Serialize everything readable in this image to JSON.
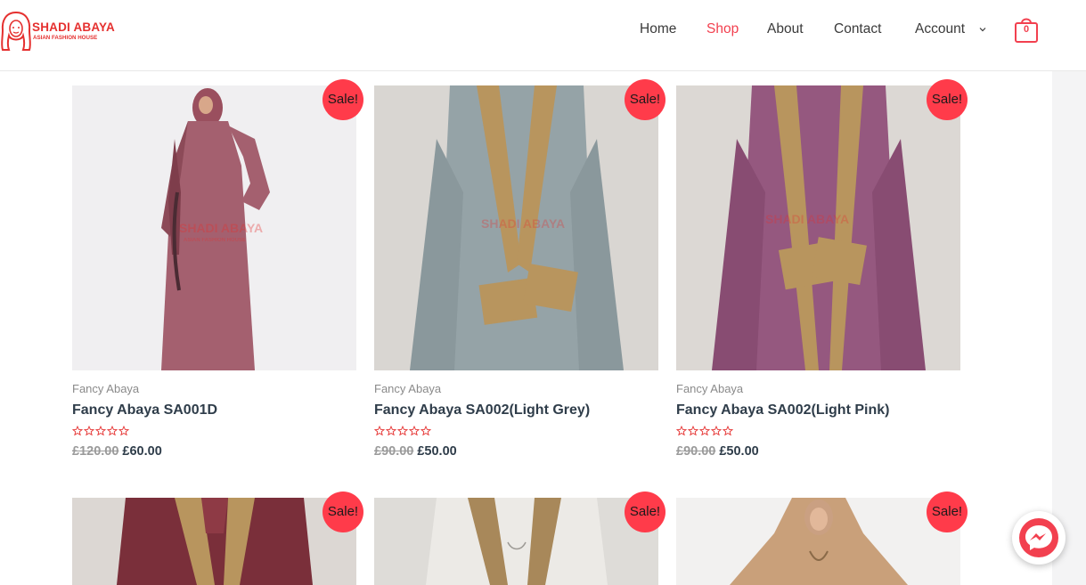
{
  "brand": {
    "name": "SHADI ABAYA",
    "tagline": "ASIAN FASHION HOUSE",
    "color": "#e5302f"
  },
  "nav": {
    "items": [
      {
        "label": "Home",
        "active": false
      },
      {
        "label": "Shop",
        "active": true
      },
      {
        "label": "About",
        "active": false
      },
      {
        "label": "Contact",
        "active": false
      },
      {
        "label": "Account",
        "active": false
      }
    ],
    "cart_count": "0",
    "accent": "#f2404f"
  },
  "products": [
    {
      "badge": "Sale!",
      "category": "Fancy Abaya",
      "title": "Fancy Abaya SA001D",
      "old_price": "£120.00",
      "price": "£60.00",
      "rating": 0,
      "image": "mauve-abaya-photo"
    },
    {
      "badge": "Sale!",
      "category": "Fancy Abaya",
      "title": "Fancy Abaya SA002(Light Grey)",
      "old_price": "£90.00",
      "price": "£50.00",
      "rating": 0,
      "image": "grey-abaya-gold-trim-photo"
    },
    {
      "badge": "Sale!",
      "category": "Fancy Abaya",
      "title": "Fancy Abaya SA002(Light Pink)",
      "old_price": "£90.00",
      "price": "£50.00",
      "rating": 0,
      "image": "pink-abaya-gold-trim-photo"
    },
    {
      "badge": "Sale!",
      "image": "maroon-abaya-gold-trim-photo"
    },
    {
      "badge": "Sale!",
      "image": "white-abaya-gold-trim-photo"
    },
    {
      "badge": "Sale!",
      "image": "beige-abaya-model-photo"
    }
  ],
  "messenger_icon": "messenger-icon"
}
